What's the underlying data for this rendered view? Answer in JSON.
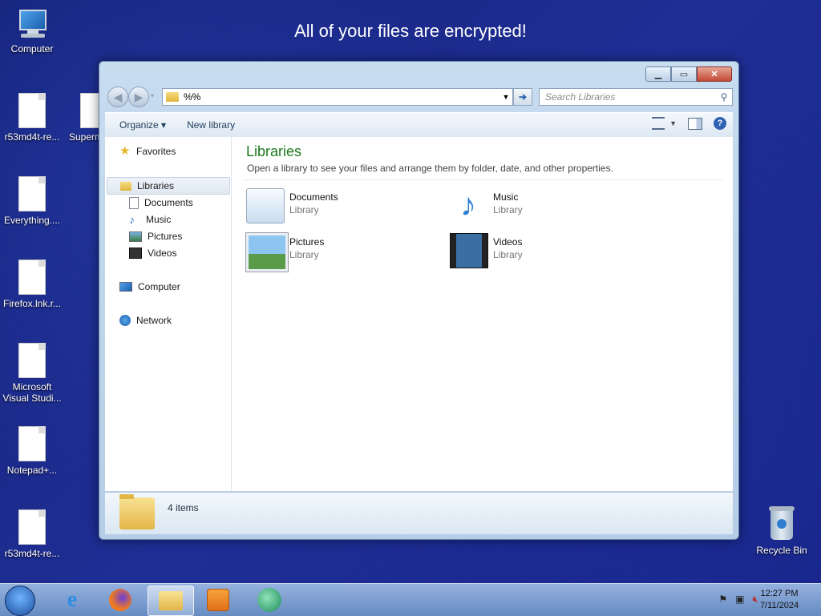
{
  "banner": "All of your files are encrypted!",
  "desktop": {
    "icons": [
      {
        "label": "Computer",
        "icon": "computer-icon"
      },
      {
        "label": "r53md4t-re...",
        "icon": "file-icon"
      },
      {
        "label": "Superm",
        "icon": "file-icon"
      },
      {
        "label": "Everything....",
        "icon": "file-icon"
      },
      {
        "label": "Firefox.lnk.r...",
        "icon": "file-icon"
      },
      {
        "label": "Microsoft Visual Studi...",
        "icon": "file-icon"
      },
      {
        "label": "Notepad+...",
        "icon": "file-icon"
      },
      {
        "label": "r53md4t-re...",
        "icon": "file-icon"
      },
      {
        "label": "Recycle Bin",
        "icon": "recycle-bin-icon"
      }
    ]
  },
  "window": {
    "address_value": "%%",
    "search_placeholder": "Search Libraries",
    "toolbar": {
      "organize": "Organize ▾",
      "new_library": "New library"
    },
    "nav": {
      "favorites": "Favorites",
      "libraries": "Libraries",
      "documents": "Documents",
      "music": "Music",
      "pictures": "Pictures",
      "videos": "Videos",
      "computer": "Computer",
      "network": "Network"
    },
    "main": {
      "heading": "Libraries",
      "subtitle": "Open a library to see your files and arrange them by folder, date, and other properties.",
      "libraries": [
        {
          "name": "Documents",
          "kind": "Library"
        },
        {
          "name": "Music",
          "kind": "Library"
        },
        {
          "name": "Pictures",
          "kind": "Library"
        },
        {
          "name": "Videos",
          "kind": "Library"
        }
      ]
    },
    "status": {
      "count": "4 items"
    }
  },
  "taskbar": {
    "time": "12:27 PM",
    "date": "7/11/2024"
  },
  "colors": {
    "heading": "#1b7a1b",
    "desktop": "#1b2a8a",
    "close": "#c24a35"
  }
}
